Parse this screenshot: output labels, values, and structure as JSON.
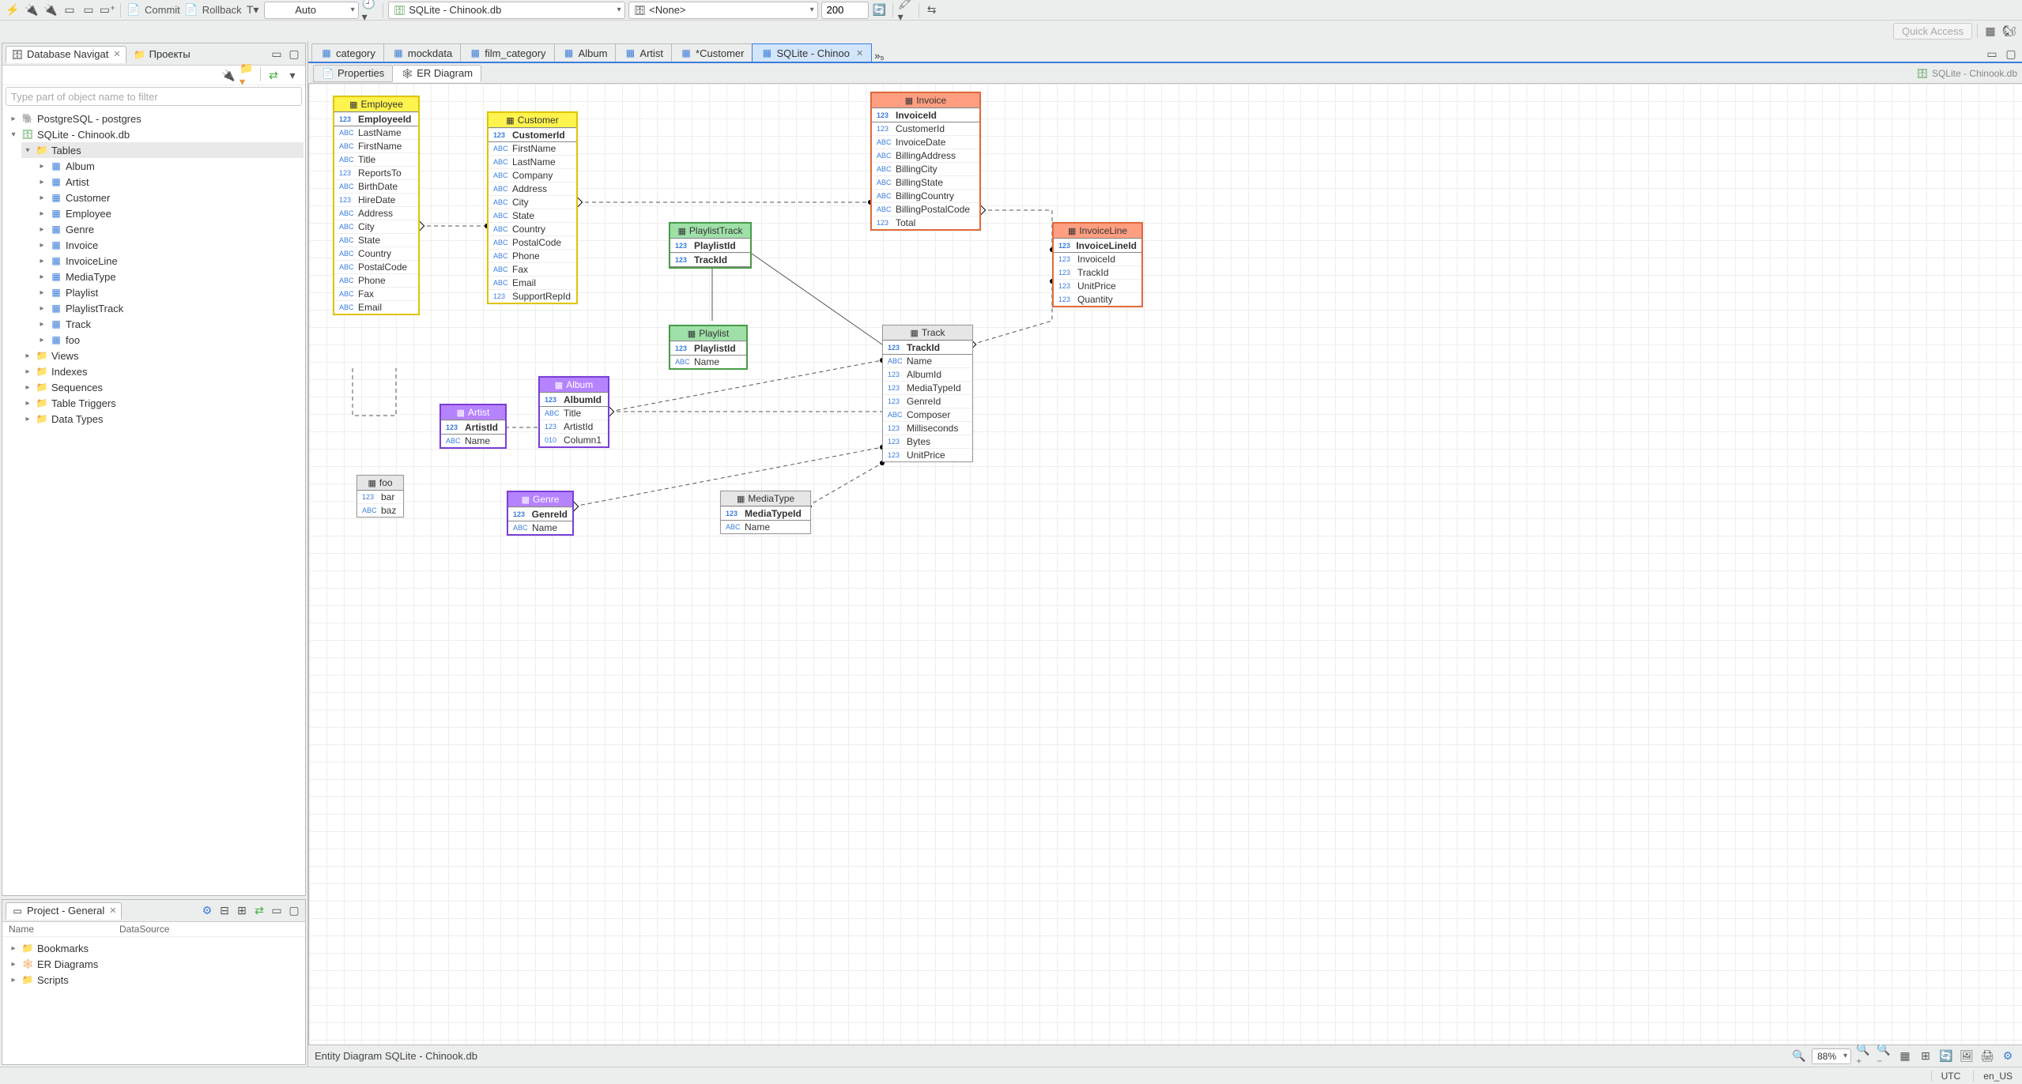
{
  "toolbar": {
    "commit": "Commit",
    "rollback": "Rollback",
    "txMode": "Auto",
    "conn1": "SQLite - Chinook.db",
    "conn2": "<None>",
    "limit": "200",
    "quickAccess": "Quick Access"
  },
  "navigator": {
    "title": "Database Navigat",
    "projectsTab": "Проекты",
    "filterPlaceholder": "Type part of object name to filter",
    "tree": {
      "pg": "PostgreSQL - postgres",
      "sqlite": "SQLite - Chinook.db",
      "tables": "Tables",
      "tableList": [
        "Album",
        "Artist",
        "Customer",
        "Employee",
        "Genre",
        "Invoice",
        "InvoiceLine",
        "MediaType",
        "Playlist",
        "PlaylistTrack",
        "Track",
        "foo"
      ],
      "views": "Views",
      "indexes": "Indexes",
      "sequences": "Sequences",
      "triggers": "Table Triggers",
      "datatypes": "Data Types"
    }
  },
  "project": {
    "title": "Project - General",
    "colName": "Name",
    "colDS": "DataSource",
    "items": [
      "Bookmarks",
      "ER Diagrams",
      "Scripts"
    ]
  },
  "editorTabs": [
    "category",
    "mockdata",
    "film_category",
    "Album",
    "Artist",
    "*Customer",
    "SQLite - Chinoo"
  ],
  "editorOverflow": "»₅",
  "subTabs": {
    "properties": "Properties",
    "erDiagram": "ER Diagram"
  },
  "crumb": "SQLite - Chinook.db",
  "entities": {
    "Employee": {
      "header": "Employee",
      "pk": "EmployeeId",
      "cols": [
        {
          "t": "ABC",
          "n": "LastName"
        },
        {
          "t": "ABC",
          "n": "FirstName"
        },
        {
          "t": "ABC",
          "n": "Title"
        },
        {
          "t": "123",
          "n": "ReportsTo"
        },
        {
          "t": "ABC",
          "n": "BirthDate"
        },
        {
          "t": "123",
          "n": "HireDate"
        },
        {
          "t": "ABC",
          "n": "Address"
        },
        {
          "t": "ABC",
          "n": "City"
        },
        {
          "t": "ABC",
          "n": "State"
        },
        {
          "t": "ABC",
          "n": "Country"
        },
        {
          "t": "ABC",
          "n": "PostalCode"
        },
        {
          "t": "ABC",
          "n": "Phone"
        },
        {
          "t": "ABC",
          "n": "Fax"
        },
        {
          "t": "ABC",
          "n": "Email"
        }
      ]
    },
    "Customer": {
      "header": "Customer",
      "pk": "CustomerId",
      "cols": [
        {
          "t": "ABC",
          "n": "FirstName"
        },
        {
          "t": "ABC",
          "n": "LastName"
        },
        {
          "t": "ABC",
          "n": "Company"
        },
        {
          "t": "ABC",
          "n": "Address"
        },
        {
          "t": "ABC",
          "n": "City"
        },
        {
          "t": "ABC",
          "n": "State"
        },
        {
          "t": "ABC",
          "n": "Country"
        },
        {
          "t": "ABC",
          "n": "PostalCode"
        },
        {
          "t": "ABC",
          "n": "Phone"
        },
        {
          "t": "ABC",
          "n": "Fax"
        },
        {
          "t": "ABC",
          "n": "Email"
        },
        {
          "t": "123",
          "n": "SupportRepId"
        }
      ]
    },
    "Invoice": {
      "header": "Invoice",
      "pk": "InvoiceId",
      "cols": [
        {
          "t": "123",
          "n": "CustomerId"
        },
        {
          "t": "ABC",
          "n": "InvoiceDate"
        },
        {
          "t": "ABC",
          "n": "BillingAddress"
        },
        {
          "t": "ABC",
          "n": "BillingCity"
        },
        {
          "t": "ABC",
          "n": "BillingState"
        },
        {
          "t": "ABC",
          "n": "BillingCountry"
        },
        {
          "t": "ABC",
          "n": "BillingPostalCode"
        },
        {
          "t": "123",
          "n": "Total"
        }
      ]
    },
    "InvoiceLine": {
      "header": "InvoiceLine",
      "pk": "InvoiceLineId",
      "cols": [
        {
          "t": "123",
          "n": "InvoiceId"
        },
        {
          "t": "123",
          "n": "TrackId"
        },
        {
          "t": "123",
          "n": "UnitPrice"
        },
        {
          "t": "123",
          "n": "Quantity"
        }
      ]
    },
    "PlaylistTrack": {
      "header": "PlaylistTrack",
      "pkLabel": "PlaylistId",
      "pk2": "TrackId"
    },
    "Playlist": {
      "header": "Playlist",
      "pk": "PlaylistId",
      "cols": [
        {
          "t": "ABC",
          "n": "Name"
        }
      ]
    },
    "Track": {
      "header": "Track",
      "pk": "TrackId",
      "cols": [
        {
          "t": "ABC",
          "n": "Name"
        },
        {
          "t": "123",
          "n": "AlbumId"
        },
        {
          "t": "123",
          "n": "MediaTypeId"
        },
        {
          "t": "123",
          "n": "GenreId"
        },
        {
          "t": "ABC",
          "n": "Composer"
        },
        {
          "t": "123",
          "n": "Milliseconds"
        },
        {
          "t": "123",
          "n": "Bytes"
        },
        {
          "t": "123",
          "n": "UnitPrice"
        }
      ]
    },
    "Artist": {
      "header": "Artist",
      "pk": "ArtistId",
      "cols": [
        {
          "t": "ABC",
          "n": "Name"
        }
      ]
    },
    "Album": {
      "header": "Album",
      "pk": "AlbumId",
      "cols": [
        {
          "t": "ABC",
          "n": "Title"
        },
        {
          "t": "123",
          "n": "ArtistId"
        },
        {
          "t": "010",
          "n": "Column1"
        }
      ]
    },
    "Genre": {
      "header": "Genre",
      "pk": "GenreId",
      "cols": [
        {
          "t": "ABC",
          "n": "Name"
        }
      ]
    },
    "MediaType": {
      "header": "MediaType",
      "pk": "MediaTypeId",
      "cols": [
        {
          "t": "ABC",
          "n": "Name"
        }
      ]
    },
    "foo": {
      "header": "foo",
      "cols": [
        {
          "t": "123",
          "n": "bar"
        },
        {
          "t": "ABC",
          "n": "baz"
        }
      ]
    }
  },
  "editorStatus": {
    "title": "Entity Diagram SQLite - Chinook.db",
    "zoom": "88%"
  },
  "statusBar": {
    "tz": "UTC",
    "locale": "en_US"
  }
}
